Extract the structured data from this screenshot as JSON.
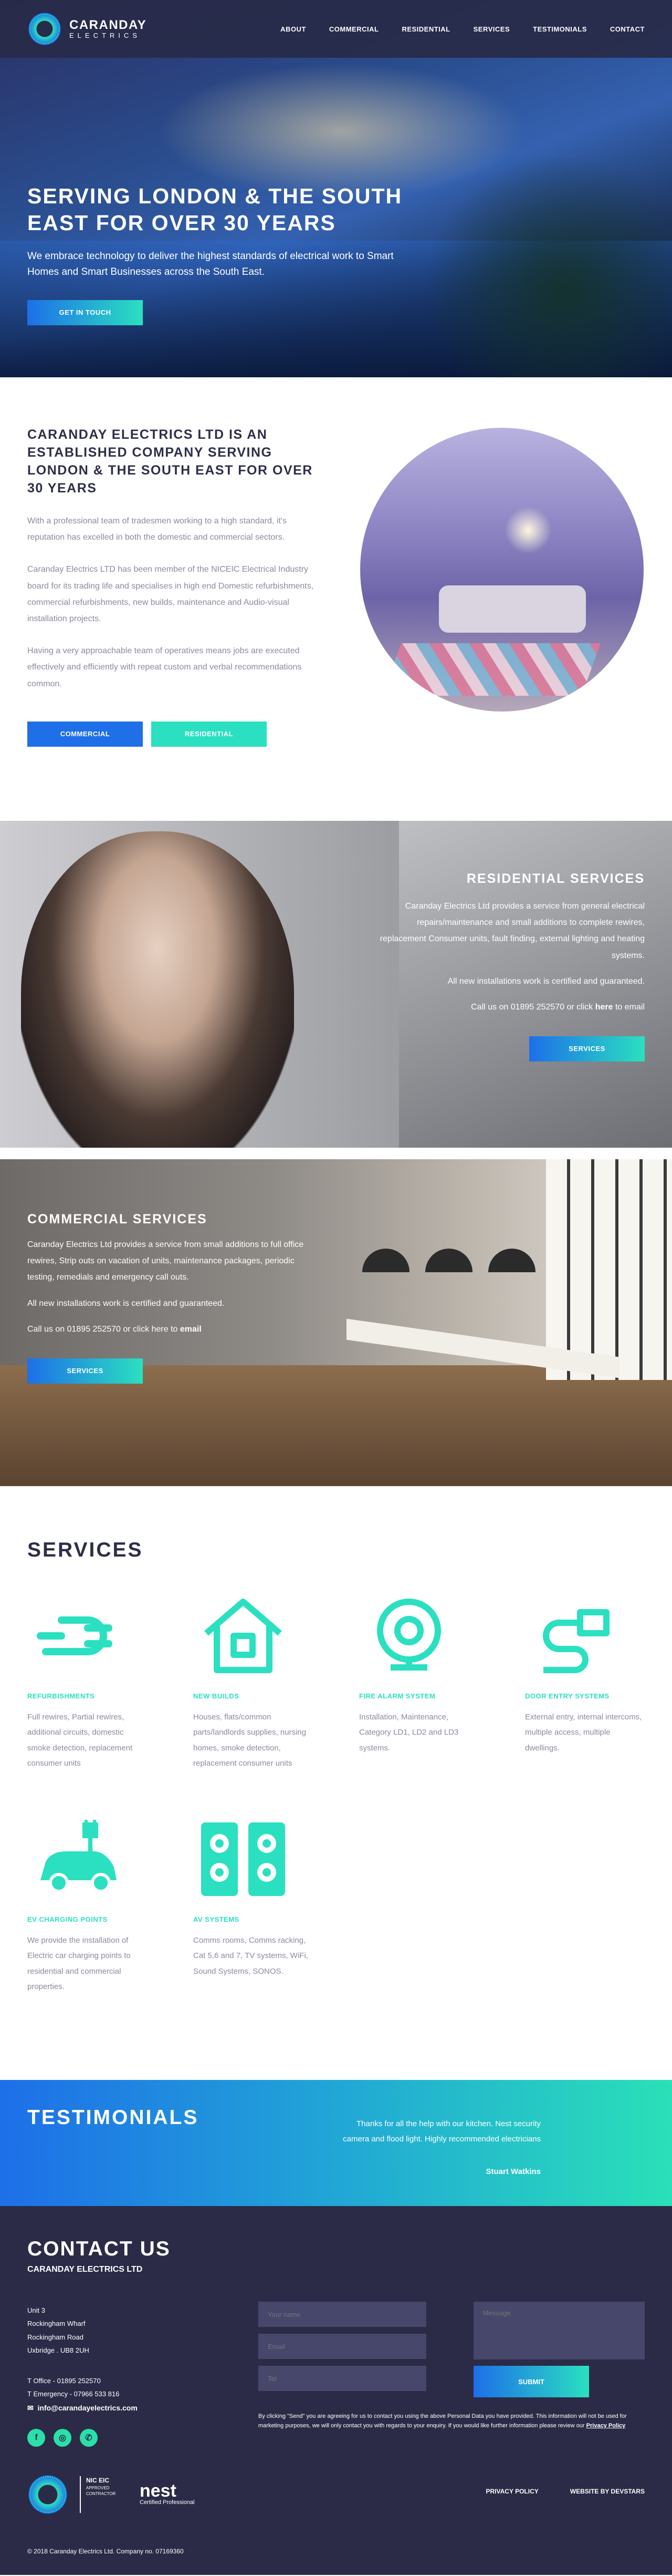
{
  "brand": {
    "name": "CARANDAY",
    "sub": "ELECTRICS"
  },
  "nav": [
    "ABOUT",
    "COMMERCIAL",
    "RESIDENTIAL",
    "SERVICES",
    "TESTIMONIALS",
    "CONTACT"
  ],
  "hero": {
    "title": "SERVING LONDON & THE SOUTH EAST FOR OVER 30 YEARS",
    "subtitle": "We embrace technology to deliver the highest standards of electrical work to Smart Homes and Smart Businesses across the South East.",
    "cta": "GET IN TOUCH"
  },
  "about": {
    "title": "CARANDAY ELECTRICS LTD IS AN ESTABLISHED COMPANY SERVING LONDON & THE SOUTH EAST FOR OVER 30 YEARS",
    "paragraphs": [
      "With a professional team of tradesmen working to a high standard, it's reputation has excelled in both the domestic and commercial sectors.",
      "Caranday Electrics LTD has been member of the NICEIC Electrical Industry board for its trading life and specialises in high end Domestic refurbishments, commercial refurbishments, new builds, maintenance and Audio-visual installation projects.",
      "Having a very approachable team of operatives means jobs are executed effectively and efficiently with repeat custom and verbal recommendations common."
    ],
    "btn_commercial": "COMMERCIAL",
    "btn_residential": "RESIDENTIAL"
  },
  "residential": {
    "title": "RESIDENTIAL SERVICES",
    "p1": "Caranday Electrics Ltd provides a service from general electrical repairs/maintenance and small additions to complete rewires, replacement Consumer units, fault finding, external lighting and heating systems.",
    "p2": "All new installations work is certified and guaranteed.",
    "call_prefix": "Call us on 01895 252570 or click",
    "call_link": "here",
    "call_suffix": "to email",
    "cta": "SERVICES"
  },
  "commercial": {
    "title": "COMMERCIAL SERVICES",
    "p1": "Caranday Electrics Ltd provides a service from small additions to full office rewires, Strip outs on vacation of units, maintenance packages, periodic testing, remedials and emergency call outs.",
    "p2": "All new installations work is certified and guaranteed.",
    "call_prefix": "Call us on 01895 252570 or click here to",
    "call_link": "email",
    "cta": "SERVICES"
  },
  "services": {
    "title": "SERVICES",
    "items": [
      {
        "icon": "cable-plug-icon",
        "name": "REFURBISHMENTS",
        "desc": "Full rewires, Partial rewires, additional circuits, domestic smoke detection, replacement consumer units"
      },
      {
        "icon": "house-icon",
        "name": "NEW BUILDS",
        "desc": "Houses, flats/common parts/landlords supplies, nursing homes, smoke detection, replacement consumer units"
      },
      {
        "icon": "alarm-bell-icon",
        "name": "FIRE ALARM SYSTEM",
        "desc": "Installation, Maintenance, Category LD1, LD2 and LD3 systems."
      },
      {
        "icon": "door-entry-icon",
        "name": "DOOR ENTRY SYSTEMS",
        "desc": "External entry, internal intercoms, multiple access, multiple dwellings."
      },
      {
        "icon": "ev-car-icon",
        "name": "EV CHARGING POINTS",
        "desc": "We provide the installation of Electric car charging points to residential and commercial properties."
      },
      {
        "icon": "speakers-icon",
        "name": "AV SYSTEMS",
        "desc": "Comms rooms, Comms racking, Cat 5,6 and 7, TV systems, WiFi, Sound Systems, SONOS."
      }
    ]
  },
  "testimonials": {
    "title": "TESTIMONIALS",
    "quote": "Thanks for all the help with our kitchen. Nest security camera and flood light. Highly recommended electricians",
    "author": "Stuart Watkins"
  },
  "contact": {
    "title": "CONTACT US",
    "company": "CARANDAY ELECTRICS LTD",
    "address": [
      "Unit 3",
      "Rockingham Wharf",
      "Rockingham Road",
      "Uxbridge . UB8 2UH"
    ],
    "office": "T Office - 01895 252570",
    "emergency": "T Emergency - 07966 533 816",
    "email": "info@carandayelectrics.com",
    "form": {
      "name_placeholder": "Your name",
      "email_placeholder": "Email",
      "tel_placeholder": "Tel",
      "message_placeholder": "Message",
      "submit": "SUBMIT"
    },
    "disclaimer": "By clicking \"Send\" you are agreeing for us to contact you using the above Personal Data you have provided. This information will not be used for marketing purposes, we will only contact you with regards to your enquiry. If you would like further information please review our",
    "privacy_link": "Privacy Policy",
    "niceic": "NIC EIC",
    "niceic_sub": "APPROVED CONTRACTOR",
    "nest": "nest",
    "nest_sub": "Certified Professional",
    "privacy": "PRIVACY POLICY",
    "website_by": "WEBSITE BY DEVSTARS",
    "copyright": "© 2018 Caranday Electrics Ltd. Company no. 07169360"
  },
  "colors": {
    "navy": "#2b2b47",
    "blue": "#1e6fe8",
    "teal": "#2ae0c0"
  }
}
